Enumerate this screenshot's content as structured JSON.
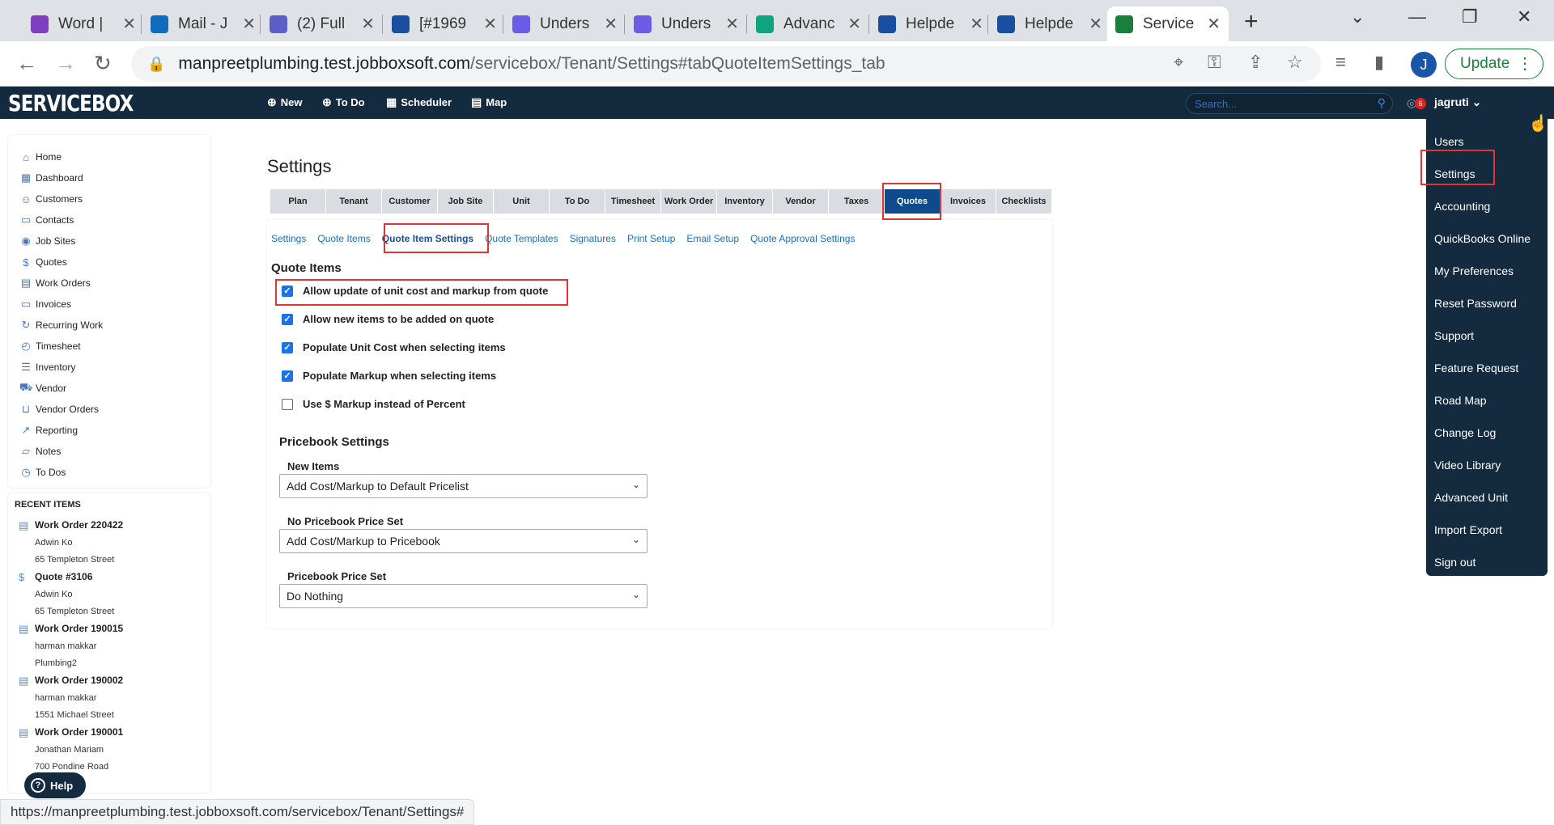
{
  "browser": {
    "tabs": [
      {
        "label": "Word |",
        "favicon_color": "#7b3fbf"
      },
      {
        "label": "Mail - J",
        "favicon_color": "#0f6cbd"
      },
      {
        "label": "(2) Full",
        "favicon_color": "#5b5fc7"
      },
      {
        "label": "[#1969",
        "favicon_color": "#1a4fa0"
      },
      {
        "label": "Unders",
        "favicon_color": "#6c5ce7"
      },
      {
        "label": "Unders",
        "favicon_color": "#6c5ce7"
      },
      {
        "label": "Advanc",
        "favicon_color": "#10a37f"
      },
      {
        "label": "Helpde",
        "favicon_color": "#1a4fa0"
      },
      {
        "label": "Helpde",
        "favicon_color": "#1a4fa0"
      },
      {
        "label": "Service",
        "favicon_color": "#188038"
      }
    ],
    "url_host": "manpreetplumbing.test.jobboxsoft.com",
    "url_path": "/servicebox/Tenant/Settings#tabQuoteItemSettings_tab",
    "profile_initial": "J",
    "update_label": "Update",
    "status_url": "https://manpreetplumbing.test.jobboxsoft.com/servicebox/Tenant/Settings#"
  },
  "app": {
    "logo": "SERVICEBOX",
    "topnav": [
      "New",
      "To Do",
      "Scheduler",
      "Map"
    ],
    "search_placeholder": "Search...",
    "notification_count": "6",
    "user": "jagruti"
  },
  "sidebar": {
    "items": [
      {
        "label": "Home",
        "icon": "home-icon"
      },
      {
        "label": "Dashboard",
        "icon": "dashboard-icon"
      },
      {
        "label": "Customers",
        "icon": "users-icon"
      },
      {
        "label": "Contacts",
        "icon": "contacts-icon"
      },
      {
        "label": "Job Sites",
        "icon": "location-icon"
      },
      {
        "label": "Quotes",
        "icon": "dollar-icon"
      },
      {
        "label": "Work Orders",
        "icon": "document-icon"
      },
      {
        "label": "Invoices",
        "icon": "invoice-icon"
      },
      {
        "label": "Recurring Work",
        "icon": "recurring-icon"
      },
      {
        "label": "Timesheet",
        "icon": "watch-icon"
      },
      {
        "label": "Inventory",
        "icon": "list-icon"
      },
      {
        "label": "Vendor",
        "icon": "truck-icon"
      },
      {
        "label": "Vendor Orders",
        "icon": "cart-icon"
      },
      {
        "label": "Reporting",
        "icon": "trend-icon"
      },
      {
        "label": "Notes",
        "icon": "note-icon"
      },
      {
        "label": "To Dos",
        "icon": "clock-icon"
      }
    ],
    "recent_title": "RECENT ITEMS",
    "recent": [
      {
        "title": "Work Order 220422",
        "lines": [
          "Adwin Ko",
          "65 Templeton Street"
        ],
        "icon": "document-icon"
      },
      {
        "title": "Quote #3106",
        "lines": [
          "Adwin Ko",
          "65 Templeton Street"
        ],
        "icon": "dollar-icon"
      },
      {
        "title": "Work Order 190015",
        "lines": [
          "harman makkar",
          "Plumbing2"
        ],
        "icon": "document-icon"
      },
      {
        "title": "Work Order 190002",
        "lines": [
          "harman makkar",
          "1551 Michael Street"
        ],
        "icon": "document-icon"
      },
      {
        "title": "Work Order 190001",
        "lines": [
          "Jonathan Mariam",
          "700 Pondine Road"
        ],
        "icon": "document-icon"
      }
    ],
    "help_label": "Help"
  },
  "main": {
    "title": "Settings",
    "tabs": [
      "Plan",
      "Tenant",
      "Customer",
      "Job Site",
      "Unit",
      "To Do",
      "Timesheet",
      "Work Order",
      "Inventory",
      "Vendor",
      "Taxes",
      "Quotes",
      "Invoices",
      "Checklists"
    ],
    "selected_tab": "Quotes",
    "subtabs": [
      "Settings",
      "Quote Items",
      "Quote Item Settings",
      "Quote Templates",
      "Signatures",
      "Print Setup",
      "Email Setup",
      "Quote Approval Settings"
    ],
    "selected_subtab": "Quote Item Settings",
    "quote_items_heading": "Quote Items",
    "checkboxes": [
      {
        "label": "Allow update of unit cost and markup from quote",
        "checked": true
      },
      {
        "label": "Allow new items to be added on quote",
        "checked": true
      },
      {
        "label": "Populate Unit Cost when selecting items",
        "checked": true
      },
      {
        "label": "Populate Markup when selecting items",
        "checked": true
      },
      {
        "label": "Use $ Markup instead of Percent",
        "checked": false
      }
    ],
    "pricebook_heading": "Pricebook Settings",
    "fields": [
      {
        "label": "New Items",
        "value": "Add Cost/Markup to Default Pricelist"
      },
      {
        "label": "No Pricebook Price Set",
        "value": "Add Cost/Markup to Pricebook"
      },
      {
        "label": "Pricebook Price Set",
        "value": "Do Nothing"
      }
    ]
  },
  "user_menu": {
    "items": [
      "Users",
      "Settings",
      "Accounting",
      "QuickBooks Online",
      "My Preferences",
      "Reset Password",
      "Support",
      "Feature Request",
      "Road Map",
      "Change Log",
      "Video Library",
      "Advanced Unit",
      "Import Export",
      "Sign out"
    ]
  },
  "colors": {
    "app_header": "#142a3e",
    "selected_tab": "#0f4a8c",
    "highlight_box": "#e03535",
    "link": "#1a6fc4"
  }
}
